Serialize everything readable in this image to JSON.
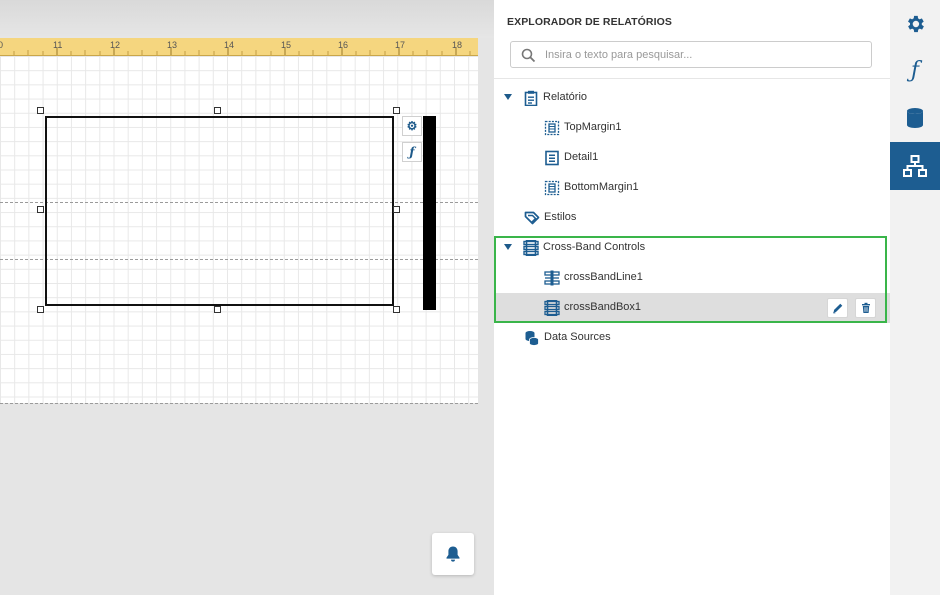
{
  "ruler": {
    "ticks": [
      "0",
      "11",
      "12",
      "13",
      "14",
      "15",
      "16",
      "17",
      "18"
    ]
  },
  "explorer": {
    "title": "EXPLORADOR DE RELATÓRIOS",
    "search": {
      "placeholder": "Insira o texto para pesquisar...",
      "value": ""
    },
    "tree": {
      "relatorio": "Relatório",
      "top_margin": "TopMargin1",
      "detail": "Detail1",
      "bottom_margin": "BottomMargin1",
      "estilos": "Estilos",
      "cross_band_controls": "Cross-Band Controls",
      "cross_band_line": "crossBandLine1",
      "cross_band_box": "crossBandBox1",
      "data_sources": "Data Sources"
    }
  },
  "canvas": {
    "control_buttons": {
      "settings": "⚙",
      "function": "ƒ"
    }
  },
  "side_toolbar": {
    "items": [
      "gear-icon",
      "function-icon",
      "database-icon",
      "report-explorer-icon"
    ],
    "function_glyph": "ƒ",
    "active": "report-explorer-icon"
  },
  "colors": {
    "accent": "#1d5d91",
    "highlight": "#3ab54a",
    "ruler": "#f5d67f"
  }
}
